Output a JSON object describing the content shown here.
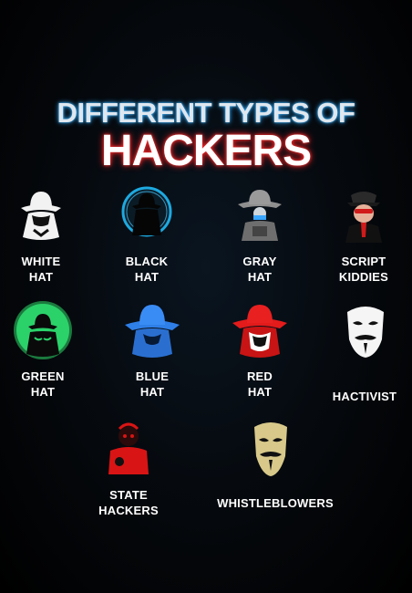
{
  "title_line1": "DIFFERENT TYPES OF",
  "title_line2": "HACKERS",
  "items": [
    {
      "line1": "WHITE",
      "line2": "HAT",
      "icon": "white-hat-hacker-icon",
      "color": "#f2f2f2"
    },
    {
      "line1": "BLACK",
      "line2": "HAT",
      "icon": "black-hat-hacker-icon",
      "color": "#1da9e0"
    },
    {
      "line1": "GRAY",
      "line2": "HAT",
      "icon": "gray-hat-hacker-icon",
      "color": "#9a9a9a"
    },
    {
      "line1": "SCRIPT",
      "line2": "KIDDIES",
      "icon": "script-kiddie-icon",
      "color": "#d11a1a"
    },
    {
      "line1": "GREEN",
      "line2": "HAT",
      "icon": "green-hat-hacker-icon",
      "color": "#2bd26a"
    },
    {
      "line1": "BLUE",
      "line2": "HAT",
      "icon": "blue-hat-hacker-icon",
      "color": "#2f7fe8"
    },
    {
      "line1": "RED",
      "line2": "HAT",
      "icon": "red-hat-hacker-icon",
      "color": "#e31b1b"
    },
    {
      "line1": "HACTIVIST",
      "line2": "",
      "icon": "anonymous-mask-icon",
      "color": "#f5f5f5"
    },
    {
      "line1": "STATE",
      "line2": "HACKERS",
      "icon": "state-hacker-icon",
      "color": "#d91414"
    },
    {
      "line1": "WHISTLEBLOWERS",
      "line2": "",
      "icon": "whistleblower-mask-icon",
      "color": "#d8c98a"
    }
  ]
}
